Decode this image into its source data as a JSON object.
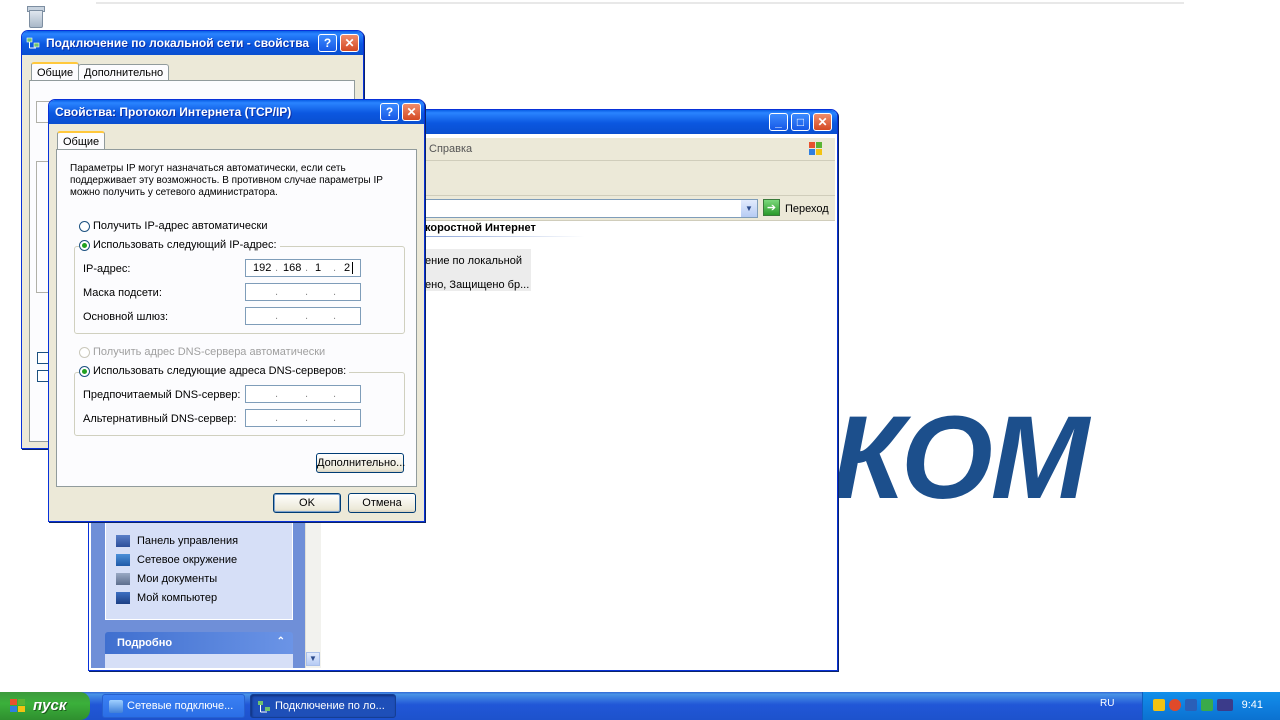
{
  "desktop": {
    "logo_text": "КОМ"
  },
  "explorer": {
    "menu_help": "Справка",
    "go_label": "Переход",
    "group_header": "коростной Интернет",
    "conn_line1": "ение по локальной",
    "conn_line2": "ено, Защищено бр...",
    "task_items": [
      "Панель управления",
      "Сетевое окружение",
      "Мои документы",
      "Мой компьютер"
    ],
    "details_header": "Подробно"
  },
  "props": {
    "title": "Подключение по локальной сети - свойства",
    "tabs": [
      "Общие",
      "Дополнительно"
    ]
  },
  "tcpip": {
    "title": "Свойства: Протокол Интернета (TCP/IP)",
    "tab": "Общие",
    "description": "Параметры IP могут назначаться автоматически, если сеть поддерживает эту возможность. В противном случае параметры IP можно получить у сетевого администратора.",
    "radio_auto_ip": "Получить IP-адрес автоматически",
    "radio_manual_ip": "Использовать следующий IP-адрес:",
    "label_ip": "IP-адрес:",
    "label_mask": "Маска подсети:",
    "label_gateway": "Основной шлюз:",
    "ip_octets": [
      "192",
      "168",
      "1",
      "2"
    ],
    "radio_auto_dns": "Получить адрес DNS-сервера автоматически",
    "radio_manual_dns": "Использовать следующие адреса DNS-серверов:",
    "label_dns1": "Предпочитаемый DNS-сервер:",
    "label_dns2": "Альтернативный DNS-сервер:",
    "advanced_button": "Дополнительно...",
    "ok_button": "OK",
    "cancel_button": "Отмена"
  },
  "taskbar": {
    "start_label": "пуск",
    "tasks": [
      "Сетевые подключе...",
      "Подключение по ло..."
    ],
    "language": "RU",
    "clock": "9:41"
  },
  "colors": {
    "xp_blue": "#0a5fe6",
    "start_green": "#3bb03b",
    "logo_blue": "#1c4f8c"
  }
}
